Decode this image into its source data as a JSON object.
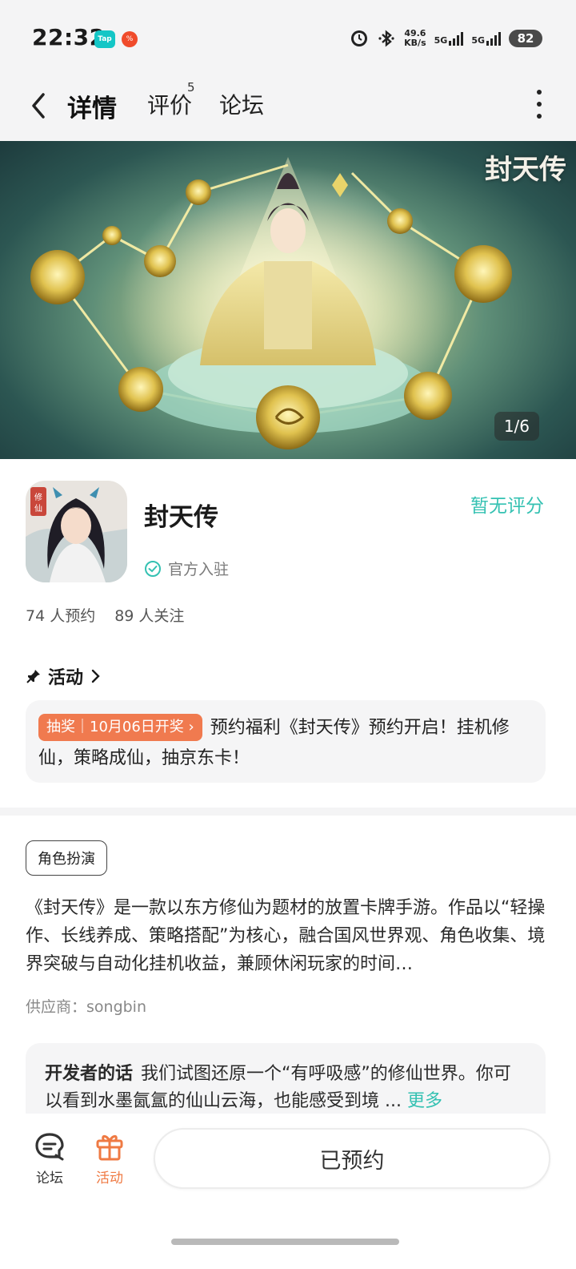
{
  "status_bar": {
    "time": "22:32",
    "app_badge_1": "Tap",
    "app_badge_2": "%",
    "speed_value": "49.6",
    "speed_unit": "KB/s",
    "net1": "5G",
    "net2": "5G",
    "battery": "82",
    "icons": [
      "alarm-icon",
      "bluetooth-icon",
      "signal-icon",
      "battery-icon"
    ]
  },
  "nav": {
    "tabs": [
      {
        "label": "详情",
        "active": true
      },
      {
        "label": "评价",
        "badge": "5"
      },
      {
        "label": "论坛"
      }
    ]
  },
  "banner": {
    "logo_text": "封天传",
    "counter": "1/6"
  },
  "app": {
    "name": "封天传",
    "rating": "暂无评分",
    "verified": "官方入驻",
    "reservations": "74 人预约",
    "followers": "89 人关注"
  },
  "activity": {
    "heading": "活动",
    "tag": "抽奖｜10月06日开奖",
    "text": "预约福利《封天传》预约开启！挂机修仙，策略成仙，抽京东卡！"
  },
  "details": {
    "genre": "角色扮演",
    "description": "《封天传》是一款以东方修仙为题材的放置卡牌手游。作品以“轻操作、长线养成、策略搭配”为核心，融合国风世界观、角色收集、境界突破与自动化挂机收益，兼顾休闲玩家的时间…",
    "supplier": "供应商：songbin"
  },
  "developer": {
    "label": "开发者的话",
    "text": "我们试图还原一个“有呼吸感”的修仙世界。你可以看到水墨氤氲的仙山云海，也能感受到境 ...",
    "more": "更多"
  },
  "bottom": {
    "forum": "论坛",
    "activity": "活动",
    "reserve": "已预约"
  },
  "colors": {
    "accent_teal": "#34c1b2",
    "accent_orange": "#ef7a43",
    "lottery_tag": "#f07a4f"
  }
}
